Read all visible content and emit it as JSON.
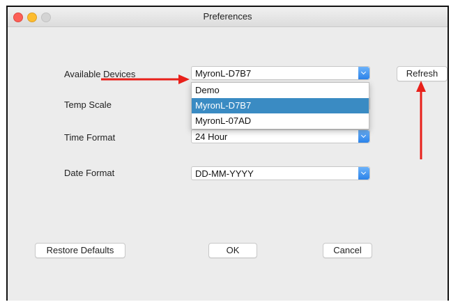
{
  "window": {
    "title": "Preferences"
  },
  "settings": {
    "available_devices_label": "Available Devices",
    "available_devices_value": "MyronL-D7B7",
    "temp_scale_label": "Temp Scale",
    "time_format_label": "Time Format",
    "time_format_value": "24 Hour",
    "date_format_label": "Date Format",
    "date_format_value": "DD-MM-YYYY"
  },
  "device_dropdown": {
    "options": [
      "Demo",
      "MyronL-D7B7",
      "MyronL-07AD"
    ],
    "selected": "MyronL-D7B7"
  },
  "buttons": {
    "refresh": "Refresh",
    "restore_defaults": "Restore Defaults",
    "ok": "OK",
    "cancel": "Cancel"
  },
  "colors": {
    "arrow": "#e8201a",
    "selection": "#3a8bc3",
    "select_arrow": "#2b82e9"
  },
  "icons": [
    "close-icon",
    "minimize-icon",
    "zoom-icon",
    "chevron-down-icon"
  ]
}
